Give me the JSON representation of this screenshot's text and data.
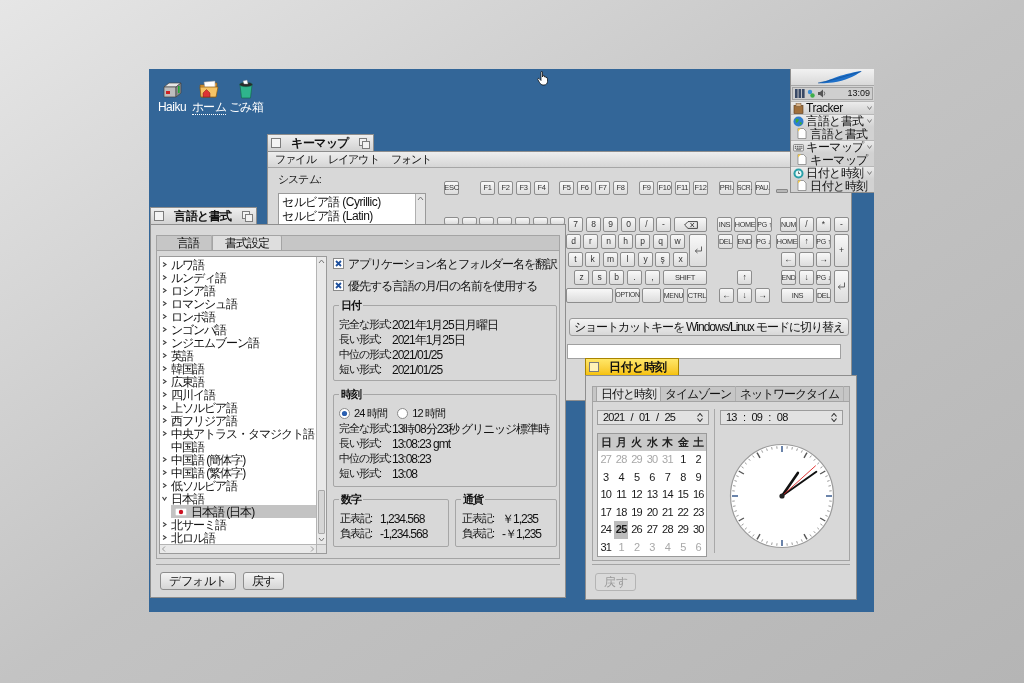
{
  "desktop": {
    "icons": [
      {
        "kind": "disk",
        "label": "Haiku",
        "selected": false
      },
      {
        "kind": "home",
        "label": "ホーム",
        "selected": true
      },
      {
        "kind": "trash",
        "label": "ごみ箱",
        "selected": false
      }
    ]
  },
  "keymap_window": {
    "title": "キーマップ",
    "active": false,
    "zoomable": true,
    "menu": [
      "ファイル",
      "レイアウト",
      "フォント"
    ],
    "system_label": "システム:",
    "layouts": [
      {
        "label": "セルビア語 (Cyrillic)",
        "selected": false
      },
      {
        "label": "セルビア語 (Latin)",
        "selected": false
      }
    ],
    "keyboard": {
      "function_keys": [
        "ESC",
        "F1",
        "F2",
        "F3",
        "F4",
        "F5",
        "F6",
        "F7",
        "F8",
        "F9",
        "F10",
        "F11",
        "F12",
        "PRI.",
        "SCR.",
        "PAU."
      ],
      "number_row": [
        "7",
        "8",
        "9",
        "0",
        "/",
        "-"
      ],
      "upper_row": [
        "d",
        "r",
        "n",
        "h",
        "p",
        "q",
        "w"
      ],
      "home_row": [
        "t",
        "k",
        "m",
        "l",
        "y",
        "ş",
        "x"
      ],
      "lower_row": [
        "z",
        "s",
        "b",
        ".",
        ",",
        "SHIFT"
      ],
      "bottom_row": [
        "OPTION",
        "MENU",
        "CTRL"
      ],
      "navigation_keys": [
        "INS",
        "HOME",
        "PG ↑",
        "DEL",
        "END",
        "PG ↓"
      ],
      "arrow_keys": [
        "↑",
        "←",
        "↓",
        "→"
      ],
      "numpad_keys": [
        "NUM",
        "/",
        "*",
        "-",
        "HOME",
        "↑",
        "PG ↑",
        "+",
        "←",
        "→",
        "END",
        "↓",
        "PG ↓",
        "INS",
        "DEL"
      ]
    },
    "shortcut_button": "ショートカットキーを Windows/Linux モードに切り替え"
  },
  "deskbar": {
    "clock": "13:09",
    "apps": [
      {
        "kind": "tracker",
        "label": "Tracker"
      },
      {
        "kind": "locale",
        "label": "言語と書式",
        "windows": [
          "言語と書式"
        ]
      },
      {
        "kind": "keymap",
        "label": "キーマップ",
        "windows": [
          "キーマップ"
        ]
      },
      {
        "kind": "clock",
        "label": "日付と時刻",
        "windows": [
          "日付と時刻"
        ]
      }
    ]
  },
  "locale_window": {
    "title": "言語と書式",
    "active": false,
    "zoomable": true,
    "tabs": [
      {
        "label": "言語",
        "selected": false
      },
      {
        "label": "書式設定",
        "selected": true
      }
    ],
    "languages": [
      {
        "label": "ルワ語",
        "kind": "group",
        "expanded": false,
        "selected": false
      },
      {
        "label": "ルンディ語",
        "kind": "group",
        "expanded": false,
        "selected": false
      },
      {
        "label": "ロシア語",
        "kind": "group",
        "expanded": false,
        "selected": false
      },
      {
        "label": "ロマンシュ語",
        "kind": "group",
        "expanded": false,
        "selected": false
      },
      {
        "label": "ロンボ語",
        "kind": "group",
        "expanded": false,
        "selected": false
      },
      {
        "label": "ンゴンバ語",
        "kind": "group",
        "expanded": false,
        "selected": false
      },
      {
        "label": "ンジエムブーン語",
        "kind": "group",
        "expanded": false,
        "selected": false
      },
      {
        "label": "英語",
        "kind": "group",
        "expanded": false,
        "selected": false
      },
      {
        "label": "韓国語",
        "kind": "group",
        "expanded": false,
        "selected": false
      },
      {
        "label": "広東語",
        "kind": "group",
        "expanded": false,
        "selected": false
      },
      {
        "label": "四川イ語",
        "kind": "group",
        "expanded": false,
        "selected": false
      },
      {
        "label": "上ソルビア語",
        "kind": "group",
        "expanded": false,
        "selected": false
      },
      {
        "label": "西フリジア語",
        "kind": "group",
        "expanded": false,
        "selected": false
      },
      {
        "label": "中央アトラス・タマジクト語",
        "kind": "group",
        "expanded": false,
        "selected": false
      },
      {
        "label": "中国語",
        "kind": "leaf",
        "selected": false
      },
      {
        "label": "中国語 (簡体字)",
        "kind": "group",
        "expanded": false,
        "selected": false
      },
      {
        "label": "中国語 (繁体字)",
        "kind": "group",
        "expanded": false,
        "selected": false
      },
      {
        "label": "低ソルビア語",
        "kind": "group",
        "expanded": false,
        "selected": false
      },
      {
        "label": "日本語",
        "kind": "group",
        "expanded": true,
        "selected": false,
        "children": [
          {
            "label": "日本語 (日本)",
            "kind": "region",
            "selected": true
          }
        ]
      },
      {
        "label": "北サーミ語",
        "kind": "group",
        "expanded": false,
        "selected": false
      },
      {
        "label": "北ロル語",
        "kind": "group",
        "expanded": false,
        "selected": false
      }
    ],
    "options": [
      {
        "label": "アプリケーション名とフォルダー名を翻訳",
        "checked": true
      },
      {
        "label": "優先する言語の月/日の名前を使用する",
        "checked": true
      }
    ],
    "date_group": {
      "title": "日付",
      "rows": [
        {
          "label": "完全な形式:",
          "value": "2021年1月25日月曜日"
        },
        {
          "label": "長い形式:",
          "value": "2021年1月25日"
        },
        {
          "label": "中位の形式:",
          "value": "2021/01/25"
        },
        {
          "label": "短い形式:",
          "value": "2021/01/25"
        }
      ]
    },
    "time_group": {
      "title": "時刻",
      "clock_modes": [
        {
          "label": "24 時間",
          "selected": true
        },
        {
          "label": "12 時間",
          "selected": false
        }
      ],
      "rows": [
        {
          "label": "完全な形式:",
          "value": "13時08分23秒 グリニッジ標準時"
        },
        {
          "label": "長い形式:",
          "value": "13:08:23 gmt"
        },
        {
          "label": "中位の形式:",
          "value": "13:08:23"
        },
        {
          "label": "短い形式:",
          "value": "13:08"
        }
      ]
    },
    "number_group": {
      "title": "数字",
      "rows": [
        {
          "label": "正表記:",
          "value": "1,234.568"
        },
        {
          "label": "負表記:",
          "value": "-1,234.568"
        }
      ]
    },
    "currency_group": {
      "title": "通貨",
      "rows": [
        {
          "label": "正表記:",
          "value": "￥1,235"
        },
        {
          "label": "負表記:",
          "value": "-￥1,235"
        }
      ]
    },
    "buttons": [
      {
        "label": "デフォルト",
        "disabled": false
      },
      {
        "label": "戻す",
        "disabled": false
      }
    ]
  },
  "datetime_window": {
    "title": "日付と時刻",
    "active": true,
    "zoomable": false,
    "tabs": [
      {
        "label": "日付と時刻",
        "selected": true
      },
      {
        "label": "タイムゾーン",
        "selected": false
      },
      {
        "label": "ネットワークタイム",
        "selected": false
      }
    ],
    "date_field": "2021 / 01 / 25",
    "time_field": "13 : 09 : 08",
    "calendar": {
      "weekdays": [
        "日",
        "月",
        "火",
        "水",
        "木",
        "金",
        "土"
      ],
      "weeks": [
        [
          {
            "label": "27",
            "dimmed": true,
            "selected": false
          },
          {
            "label": "28",
            "dimmed": true,
            "selected": false
          },
          {
            "label": "29",
            "dimmed": true,
            "selected": false
          },
          {
            "label": "30",
            "dimmed": true,
            "selected": false
          },
          {
            "label": "31",
            "dimmed": true,
            "selected": false
          },
          {
            "label": "1",
            "dimmed": false,
            "selected": false
          },
          {
            "label": "2",
            "dimmed": false,
            "selected": false
          }
        ],
        [
          {
            "label": "3",
            "dimmed": false,
            "selected": false
          },
          {
            "label": "4",
            "dimmed": false,
            "selected": false
          },
          {
            "label": "5",
            "dimmed": false,
            "selected": false
          },
          {
            "label": "6",
            "dimmed": false,
            "selected": false
          },
          {
            "label": "7",
            "dimmed": false,
            "selected": false
          },
          {
            "label": "8",
            "dimmed": false,
            "selected": false
          },
          {
            "label": "9",
            "dimmed": false,
            "selected": false
          }
        ],
        [
          {
            "label": "10",
            "dimmed": false,
            "selected": false
          },
          {
            "label": "11",
            "dimmed": false,
            "selected": false
          },
          {
            "label": "12",
            "dimmed": false,
            "selected": false
          },
          {
            "label": "13",
            "dimmed": false,
            "selected": false
          },
          {
            "label": "14",
            "dimmed": false,
            "selected": false
          },
          {
            "label": "15",
            "dimmed": false,
            "selected": false
          },
          {
            "label": "16",
            "dimmed": false,
            "selected": false
          }
        ],
        [
          {
            "label": "17",
            "dimmed": false,
            "selected": false
          },
          {
            "label": "18",
            "dimmed": false,
            "selected": false
          },
          {
            "label": "19",
            "dimmed": false,
            "selected": false
          },
          {
            "label": "20",
            "dimmed": false,
            "selected": false
          },
          {
            "label": "21",
            "dimmed": false,
            "selected": false
          },
          {
            "label": "22",
            "dimmed": false,
            "selected": false
          },
          {
            "label": "23",
            "dimmed": false,
            "selected": false
          }
        ],
        [
          {
            "label": "24",
            "dimmed": false,
            "selected": false
          },
          {
            "label": "25",
            "dimmed": false,
            "selected": true
          },
          {
            "label": "26",
            "dimmed": false,
            "selected": false
          },
          {
            "label": "27",
            "dimmed": false,
            "selected": false
          },
          {
            "label": "28",
            "dimmed": false,
            "selected": false
          },
          {
            "label": "29",
            "dimmed": false,
            "selected": false
          },
          {
            "label": "30",
            "dimmed": false,
            "selected": false
          }
        ],
        [
          {
            "label": "31",
            "dimmed": false,
            "selected": false
          },
          {
            "label": "1",
            "dimmed": true,
            "selected": false
          },
          {
            "label": "2",
            "dimmed": true,
            "selected": false
          },
          {
            "label": "3",
            "dimmed": true,
            "selected": false
          },
          {
            "label": "4",
            "dimmed": true,
            "selected": false
          },
          {
            "label": "5",
            "dimmed": true,
            "selected": false
          },
          {
            "label": "6",
            "dimmed": true,
            "selected": false
          }
        ]
      ]
    },
    "buttons": [
      {
        "label": "戻す",
        "disabled": true
      }
    ]
  }
}
